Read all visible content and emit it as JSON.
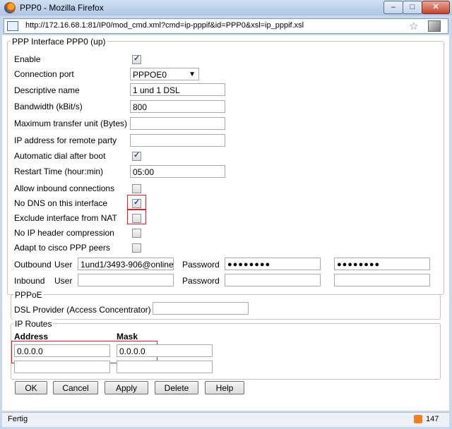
{
  "window": {
    "title": "PPP0 - Mozilla Firefox",
    "controls": {
      "minimize": "–",
      "maximize": "□",
      "close": "✕"
    }
  },
  "urlbar": {
    "url": "http://172.16.68.1:81/IP0/mod_cmd.xml?cmd=ip-pppif&id=PPP0&xsl=ip_pppif.xsl"
  },
  "form": {
    "legend": "PPP Interface PPP0  (up)",
    "enable_label": "Enable",
    "enable_checked": true,
    "connection_port_label": "Connection port",
    "connection_port_value": "PPPOE0",
    "descriptive_name_label": "Descriptive name",
    "descriptive_name_value": "1 und 1 DSL",
    "bandwidth_label": "Bandwidth (kBit/s)",
    "bandwidth_value": "800",
    "mtu_label": "Maximum transfer unit (Bytes)",
    "mtu_value": "",
    "remote_ip_label": "IP address for remote party",
    "remote_ip_value": "",
    "auto_dial_label": "Automatic dial after boot",
    "auto_dial_checked": true,
    "restart_time_label": "Restart Time (hour:min)",
    "restart_time_value": "05:00",
    "allow_inbound_label": "Allow inbound connections",
    "allow_inbound_checked": false,
    "no_dns_label": "No DNS on this interface",
    "no_dns_checked": true,
    "exclude_nat_label": "Exclude interface from NAT",
    "exclude_nat_checked": false,
    "no_ip_header_label": "No IP header compression",
    "no_ip_header_checked": false,
    "cisco_label": "Adapt to cisco PPP peers",
    "cisco_checked": false,
    "outbound_label": "Outbound",
    "inbound_label": "Inbound",
    "user_label": "User",
    "password_label": "Password",
    "outbound_user_value": "1und1/3493-906@online",
    "outbound_password_mask": "●●●●●●●●",
    "outbound_password_confirm_mask": "●●●●●●●●"
  },
  "pppoe": {
    "legend": "PPPoE",
    "dsl_provider_label": "DSL Provider (Access Concentrator)",
    "dsl_provider_value": ""
  },
  "routes": {
    "legend": "IP Routes",
    "address_header": "Address",
    "mask_header": "Mask",
    "rows": [
      {
        "address": "0.0.0.0",
        "mask": "0.0.0.0"
      },
      {
        "address": "",
        "mask": ""
      }
    ]
  },
  "buttons": {
    "ok": "OK",
    "cancel": "Cancel",
    "apply": "Apply",
    "delete": "Delete",
    "help": "Help"
  },
  "status": {
    "text": "Fertig",
    "feed_count": "147"
  },
  "colors": {
    "highlight": "#e02020",
    "checkmark": "#214a93"
  }
}
